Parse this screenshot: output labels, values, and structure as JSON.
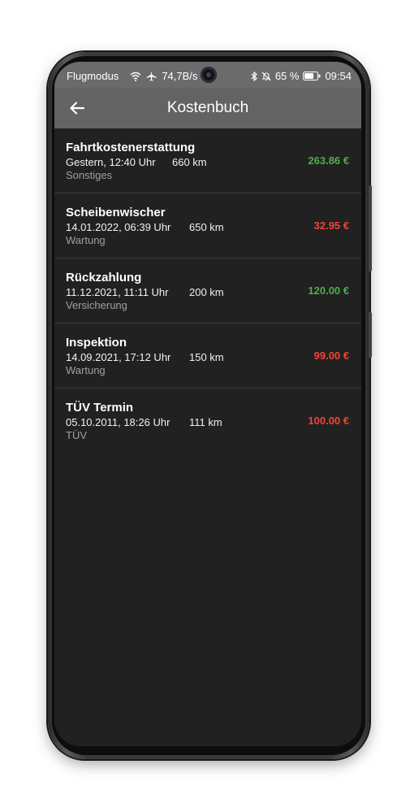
{
  "statusbar": {
    "left_text": "Flugmodus",
    "network_speed": "74,7B/s",
    "battery": "65 %",
    "time": "09:54"
  },
  "appbar": {
    "title": "Kostenbuch",
    "back_icon": "arrow-left-icon"
  },
  "colors": {
    "income": "#4caf50",
    "expense": "#f44336"
  },
  "entries": [
    {
      "title": "Fahrtkostenerstattung",
      "date": "Gestern, 12:40 Uhr",
      "km": "660 km",
      "category": "Sonstiges",
      "amount": "263.86 €",
      "type": "income"
    },
    {
      "title": "Scheibenwischer",
      "date": "14.01.2022, 06:39 Uhr",
      "km": "650 km",
      "category": "Wartung",
      "amount": "32.95 €",
      "type": "expense"
    },
    {
      "title": "Rückzahlung",
      "date": "11.12.2021, 11:11 Uhr",
      "km": "200 km",
      "category": "Versicherung",
      "amount": "120.00 €",
      "type": "income"
    },
    {
      "title": "Inspektion",
      "date": "14.09.2021, 17:12 Uhr",
      "km": "150 km",
      "category": "Wartung",
      "amount": "99.00 €",
      "type": "expense"
    },
    {
      "title": "TÜV Termin",
      "date": "05.10.2011, 18:26 Uhr",
      "km": "111 km",
      "category": "TÜV",
      "amount": "100.00 €",
      "type": "expense"
    }
  ]
}
